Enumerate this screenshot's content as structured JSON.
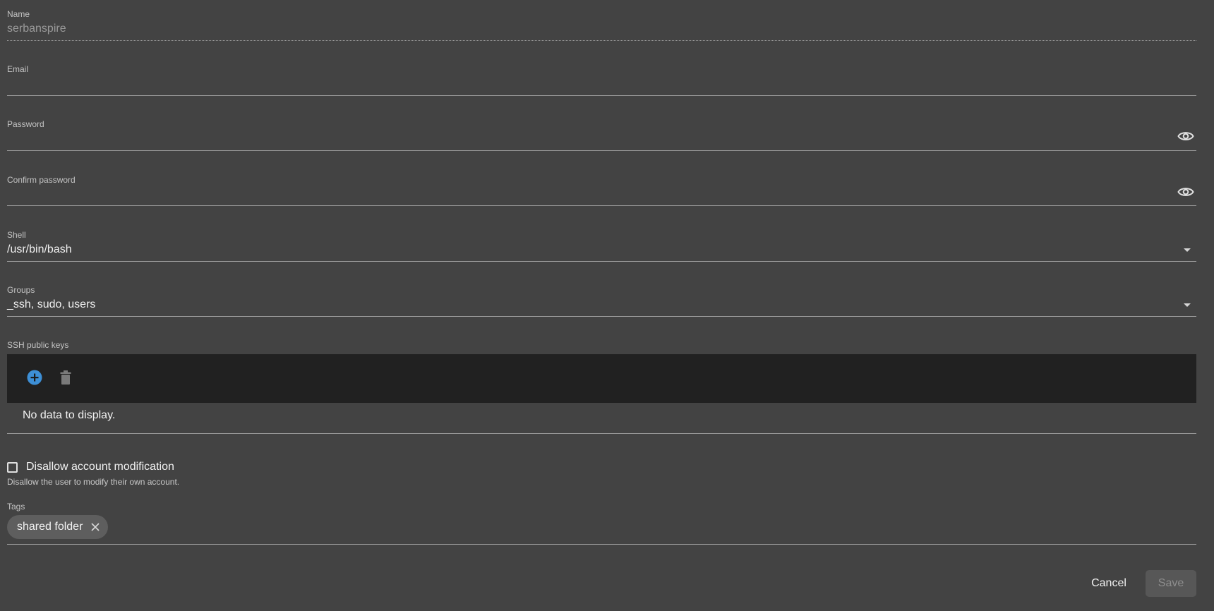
{
  "form": {
    "name": {
      "label": "Name",
      "value": "serbanspire"
    },
    "email": {
      "label": "Email",
      "value": ""
    },
    "password": {
      "label": "Password",
      "value": ""
    },
    "confirm_password": {
      "label": "Confirm password",
      "value": ""
    },
    "shell": {
      "label": "Shell",
      "value": "/usr/bin/bash"
    },
    "groups": {
      "label": "Groups",
      "value": "_ssh, sudo, users"
    },
    "ssh_keys": {
      "label": "SSH public keys",
      "empty_text": "No data to display.",
      "add_icon": "add-circle-icon",
      "delete_icon": "trash-icon"
    },
    "disallow_modification": {
      "label": "Disallow account modification",
      "hint": "Disallow the user to modify their own account.",
      "checked": false
    },
    "tags": {
      "label": "Tags",
      "items": [
        {
          "text": "shared folder"
        }
      ]
    }
  },
  "actions": {
    "cancel_label": "Cancel",
    "save_label": "Save"
  },
  "colors": {
    "background": "#434343",
    "toolbar": "#212121",
    "accent": "#3d8fd6",
    "chip": "#5e5e5e"
  }
}
